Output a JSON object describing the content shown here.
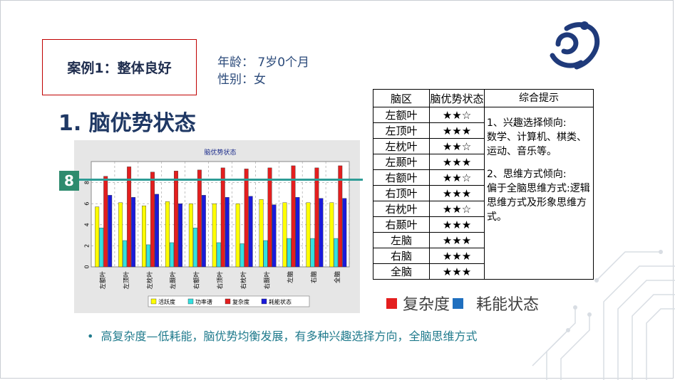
{
  "case_label": "案例1：整体良好",
  "info": {
    "age": "年龄： 7岁0个月",
    "gender": "性别：女"
  },
  "section_title": "1. 脑优势状态",
  "marker_value": "8",
  "chart_data": {
    "type": "bar",
    "title": "脑优势状态",
    "categories": [
      "左额叶",
      "左顶叶",
      "左枕叶",
      "左颞叶",
      "右额叶",
      "右顶叶",
      "右枕叶",
      "右颞叶",
      "左脑",
      "右脑",
      "全脑"
    ],
    "series": [
      {
        "name": "活跃度",
        "color": "#ffff00",
        "values": [
          5.7,
          6.1,
          5.8,
          6.2,
          6.0,
          6.0,
          6.0,
          6.4,
          6.1,
          6.1,
          6.1
        ]
      },
      {
        "name": "功率谱",
        "color": "#33e0e0",
        "values": [
          3.7,
          2.5,
          2.1,
          2.3,
          3.7,
          2.3,
          2.2,
          2.5,
          2.7,
          2.7,
          2.7
        ]
      },
      {
        "name": "复杂度",
        "color": "#e41e1e",
        "values": [
          8.6,
          9.5,
          9.0,
          9.1,
          9.2,
          9.4,
          9.3,
          9.4,
          9.6,
          9.4,
          9.6
        ]
      },
      {
        "name": "耗能状态",
        "color": "#1a1adb",
        "values": [
          6.8,
          6.6,
          6.9,
          6.0,
          6.8,
          6.6,
          6.7,
          5.9,
          6.6,
          6.5,
          6.5
        ]
      }
    ],
    "ylim": [
      0,
      10
    ],
    "yticks": [
      "0",
      "2",
      "4",
      "6",
      "8"
    ],
    "grid": true,
    "legend_position": "bottom"
  },
  "table": {
    "headers": [
      "脑区",
      "脑优势状态",
      "综合提示"
    ],
    "rows": [
      {
        "region": "左额叶",
        "stars": "★★☆"
      },
      {
        "region": "左顶叶",
        "stars": "★★★"
      },
      {
        "region": "左枕叶",
        "stars": "★★☆"
      },
      {
        "region": "左颞叶",
        "stars": "★★★"
      },
      {
        "region": "右额叶",
        "stars": "★★☆"
      },
      {
        "region": "右顶叶",
        "stars": "★★★"
      },
      {
        "region": "右枕叶",
        "stars": "★★☆"
      },
      {
        "region": "右颞叶",
        "stars": "★★★"
      },
      {
        "region": "左脑",
        "stars": "★★★"
      },
      {
        "region": "右脑",
        "stars": "★★★"
      },
      {
        "region": "全脑",
        "stars": "★★★"
      }
    ],
    "hint_1_title": "1、兴趣选择倾向:",
    "hint_1_body": "数学、计算机、棋类、运动、音乐等。",
    "hint_2_title": "2、思维方式倾向:",
    "hint_2_body": "偏于全脑思维方式:逻辑思维方式及形象思维方式。"
  },
  "legend2": [
    {
      "label": "复杂度",
      "color": "#e41e1e"
    },
    {
      "label": "耗能状态",
      "color": "#1f6fbf"
    }
  ],
  "bullet_text": "高复杂度—低耗能，脑优势均衡发展，有多种兴趣选择方向，全脑思维方式"
}
